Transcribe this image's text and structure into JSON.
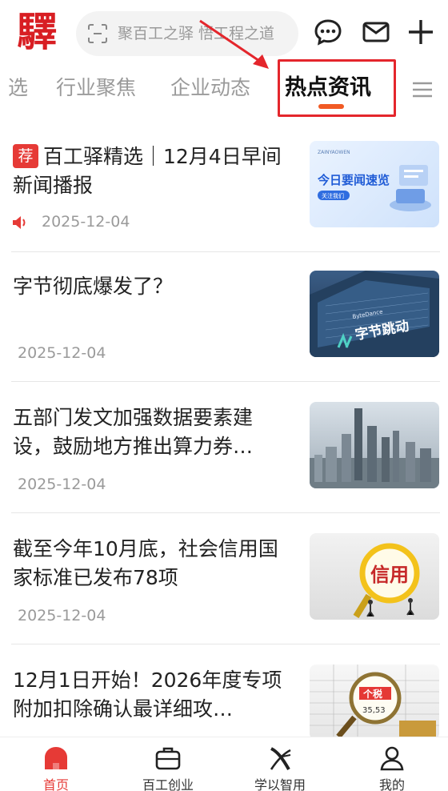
{
  "header": {
    "logo_char": "驛",
    "search_placeholder": "聚百工之驿 悟工程之道",
    "icons": [
      "chat-icon",
      "mail-icon",
      "plus-icon"
    ]
  },
  "tabs": [
    {
      "label": "选",
      "active": false
    },
    {
      "label": "行业聚焦",
      "active": false
    },
    {
      "label": "企业动态",
      "active": false
    },
    {
      "label": "热点资讯",
      "active": true
    }
  ],
  "accent_color": "#e63a36",
  "feed": [
    {
      "tag": "荐",
      "title": "百工驿精选｜12月4日早间新闻播报",
      "date": "2025-12-04",
      "thumb_text": "今日要闻速览",
      "thumb_sub": "关注我们",
      "thumb_brand": "ZAINYAOWEN"
    },
    {
      "title": "字节彻底爆发了？",
      "date": "2025-12-04",
      "thumb_text": "字节跳动",
      "thumb_sub": "ByteDance"
    },
    {
      "title": "五部门发文加强数据要素建设，鼓励地方推出算力券…",
      "date": "2025-12-04"
    },
    {
      "title": "截至今年10月底，社会信用国家标准已发布78项",
      "date": "2025-12-04",
      "thumb_text": "信用"
    },
    {
      "title": "12月1日开始！2026年度专项附加扣除确认最详细攻…",
      "date": "",
      "thumb_text": "个税",
      "thumb_sub": "35,53"
    }
  ],
  "bottom_nav": [
    {
      "label": "首页",
      "active": true,
      "icon": "home-icon"
    },
    {
      "label": "百工创业",
      "active": false,
      "icon": "briefcase-icon"
    },
    {
      "label": "学以智用",
      "active": false,
      "icon": "logo-x-icon"
    },
    {
      "label": "我的",
      "active": false,
      "icon": "user-icon"
    }
  ]
}
